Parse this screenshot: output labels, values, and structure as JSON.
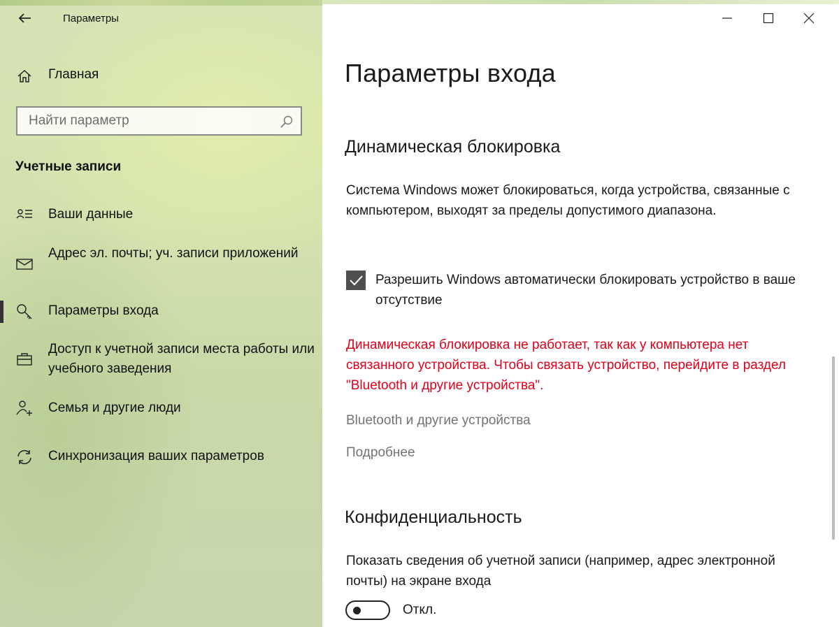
{
  "window": {
    "title": "Параметры",
    "controls": [
      "minimize-icon",
      "maximize-icon",
      "close-icon"
    ]
  },
  "sidebar": {
    "home_label": "Главная",
    "search_placeholder": "Найти параметр",
    "section_title": "Учетные записи",
    "items": [
      {
        "label": "Ваши данные",
        "icon": "person-card-icon"
      },
      {
        "label": "Адрес эл. почты; уч. записи приложений",
        "icon": "mail-icon"
      },
      {
        "label": "Параметры входа",
        "icon": "key-icon",
        "active": true
      },
      {
        "label": "Доступ к учетной записи места работы или учебного заведения",
        "icon": "briefcase-icon"
      },
      {
        "label": "Семья и другие люди",
        "icon": "person-add-icon"
      },
      {
        "label": "Синхронизация ваших параметров",
        "icon": "sync-icon"
      }
    ]
  },
  "main": {
    "title": "Параметры входа",
    "dynamic_lock": {
      "heading": "Динамическая блокировка",
      "description": "Система Windows может блокироваться, когда устройства, связанные с компьютером, выходят за пределы допустимого диапазона.",
      "checkbox_label": "Разрешить Windows автоматически блокировать устройство в ваше отсутствие",
      "checkbox_checked": true,
      "warning": "Динамическая блокировка не работает, так как у компьютера нет связанного устройства. Чтобы связать устройство, перейдите в раздел \"Bluetooth и другие устройства\".",
      "link_bluetooth": "Bluetooth и другие устройства",
      "link_more": "Подробнее"
    },
    "privacy": {
      "heading": "Конфиденциальность",
      "description": "Показать сведения об учетной записи (например, адрес электронной почты) на экране входа",
      "toggle_on": false,
      "toggle_label": "Откл."
    }
  },
  "colors": {
    "warning": "#e2001a",
    "link": "#737373",
    "checkbox": "#4f4f4f"
  }
}
